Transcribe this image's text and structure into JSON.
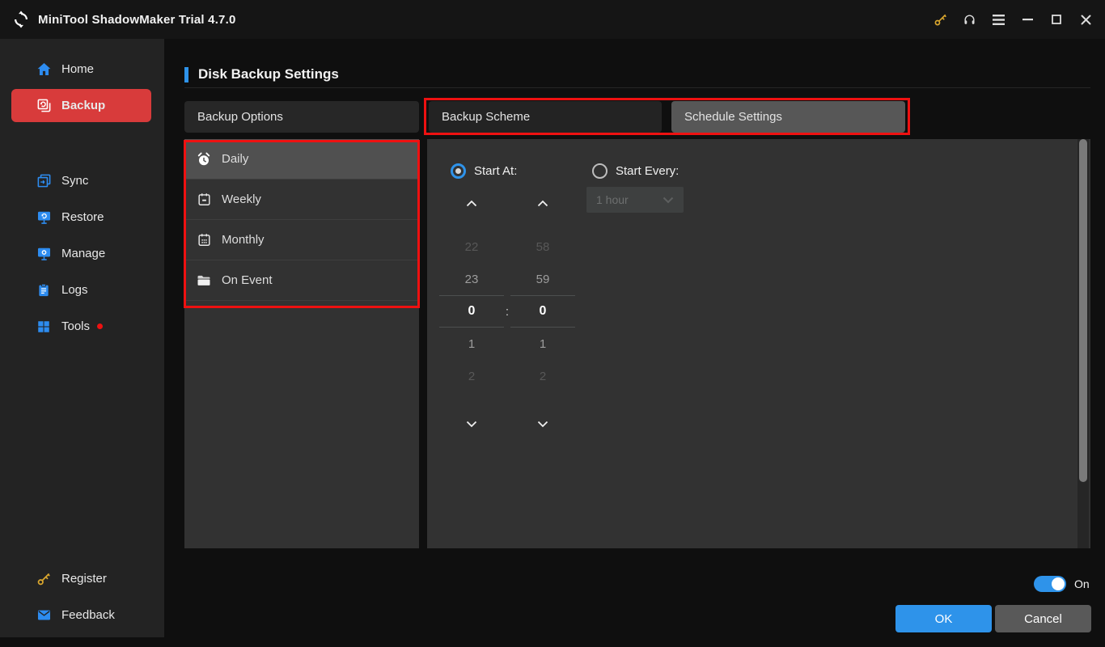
{
  "window": {
    "title": "MiniTool ShadowMaker Trial 4.7.0",
    "titlebar_icons": [
      {
        "name": "license-key-icon",
        "glyph": "key",
        "color": "#d9a62e"
      },
      {
        "name": "support-headset-icon",
        "glyph": "headset"
      },
      {
        "name": "menu-icon",
        "glyph": "hamburger"
      },
      {
        "name": "minimize-button",
        "glyph": "—"
      },
      {
        "name": "maximize-button",
        "glyph": "▢"
      },
      {
        "name": "close-button",
        "glyph": "✕"
      }
    ]
  },
  "sidebar": {
    "items": [
      {
        "label": "Home",
        "icon": "home-icon",
        "active": false
      },
      {
        "label": "Backup",
        "icon": "backup-icon",
        "active": true
      },
      {
        "label": "Sync",
        "icon": "sync-icon",
        "active": false
      },
      {
        "label": "Restore",
        "icon": "restore-icon",
        "active": false
      },
      {
        "label": "Manage",
        "icon": "manage-icon",
        "active": false
      },
      {
        "label": "Logs",
        "icon": "logs-icon",
        "active": false
      },
      {
        "label": "Tools",
        "icon": "tools-icon",
        "active": false,
        "badge": "red-dot"
      }
    ],
    "bottom_items": [
      {
        "label": "Register",
        "icon": "key-icon"
      },
      {
        "label": "Feedback",
        "icon": "envelope-icon"
      }
    ]
  },
  "main": {
    "page_title": "Disk Backup Settings",
    "tabs": [
      {
        "label": "Backup Options",
        "selected": false,
        "highlighted": false
      },
      {
        "label": "Backup Scheme",
        "selected": false,
        "highlighted": true
      },
      {
        "label": "Schedule Settings",
        "selected": true,
        "highlighted": true
      }
    ],
    "schedule_types": [
      {
        "label": "Daily",
        "icon": "alarm-clock-icon",
        "selected": true
      },
      {
        "label": "Weekly",
        "icon": "calendar-week-icon",
        "selected": false
      },
      {
        "label": "Monthly",
        "icon": "calendar-month-icon",
        "selected": false
      },
      {
        "label": "On Event",
        "icon": "folder-icon",
        "selected": false
      }
    ],
    "start_at": {
      "label": "Start At:",
      "selected": true
    },
    "start_every": {
      "label": "Start Every:",
      "selected": false,
      "interval_value": "1 hour",
      "disabled": true
    },
    "time_picker": {
      "hours": [
        "22",
        "23",
        "0",
        "1",
        "2"
      ],
      "minutes": [
        "58",
        "59",
        "0",
        "1",
        "2"
      ],
      "selected_hour": "0",
      "selected_minute": "0",
      "separator": ":"
    },
    "schedule_toggle": {
      "state_label": "On",
      "enabled": true
    },
    "buttons": {
      "ok": "OK",
      "cancel": "Cancel"
    }
  },
  "colors": {
    "accent_blue": "#2e93ea",
    "icon_blue": "#2d8cf0",
    "active_red": "#d83b3b",
    "highlight_red": "#ee1111",
    "panel_gray": "#323232",
    "selected_gray": "#505050"
  }
}
